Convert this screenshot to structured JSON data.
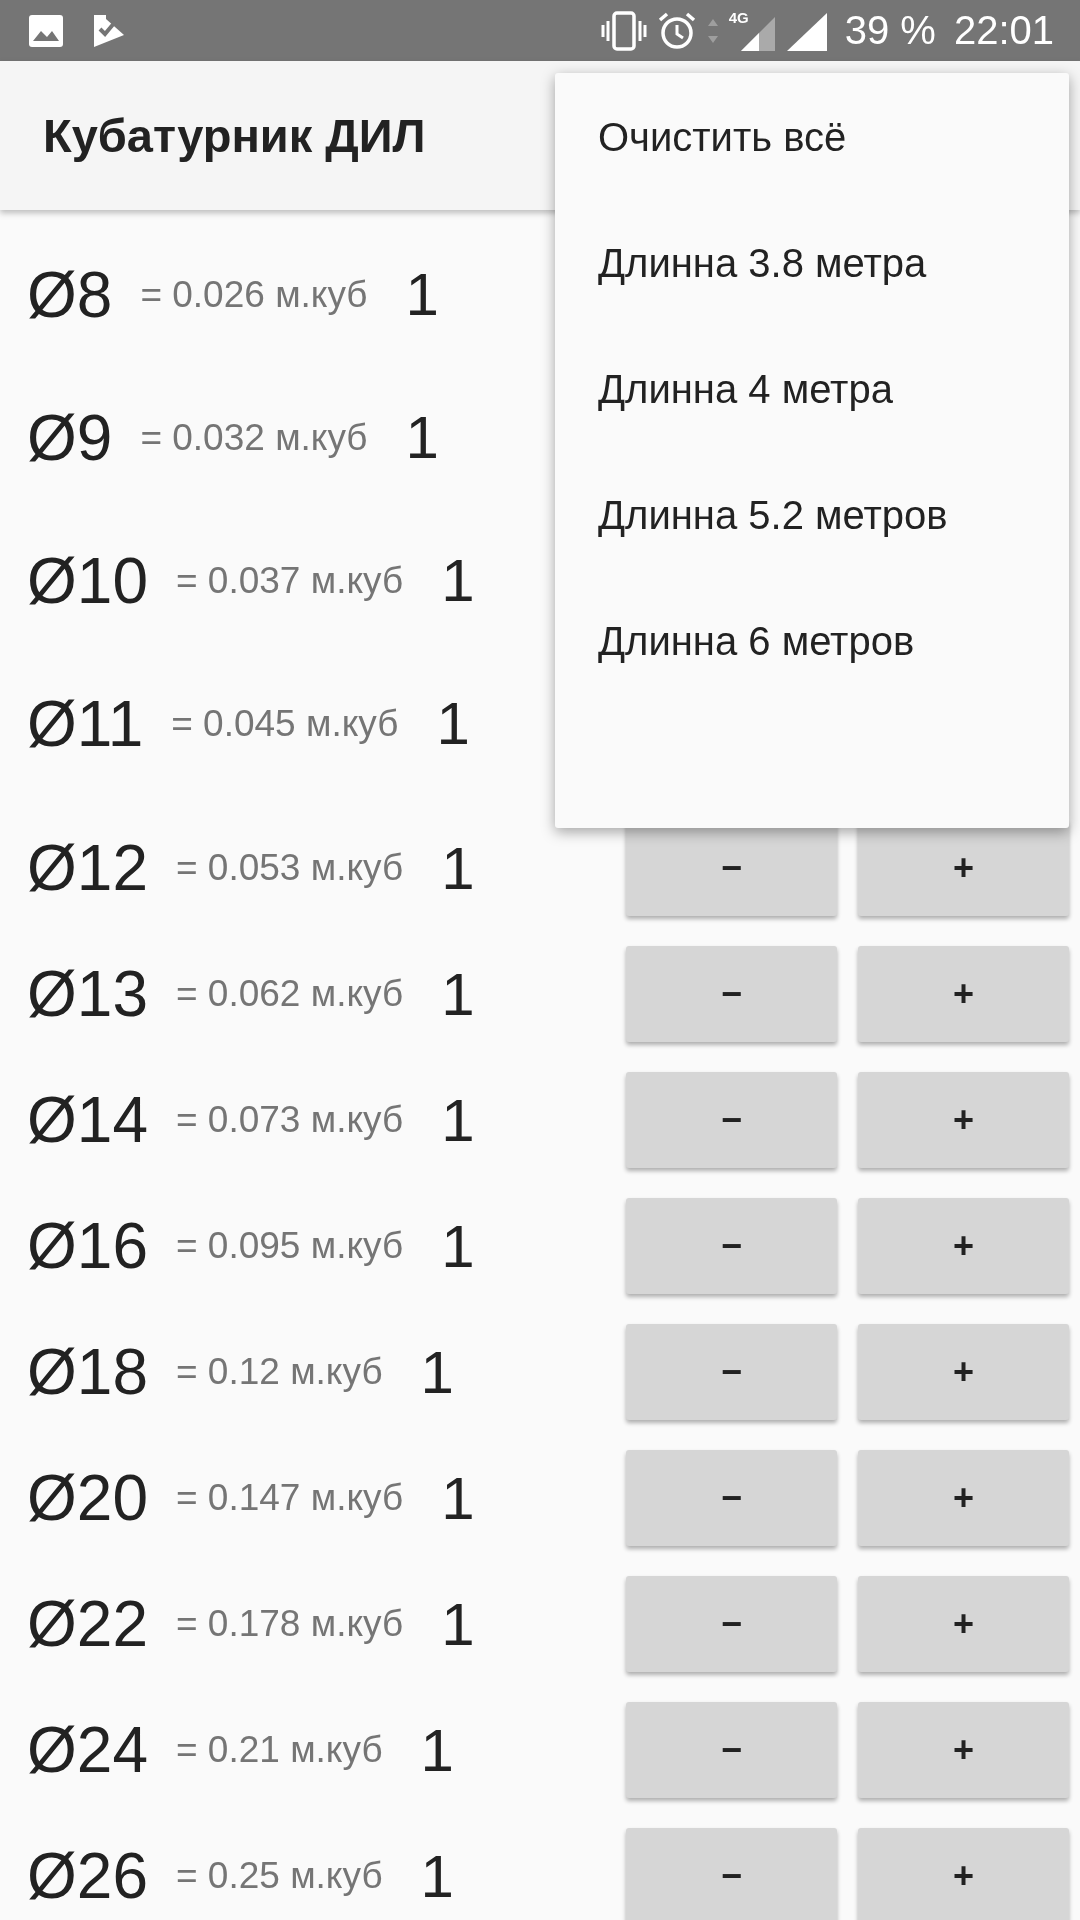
{
  "status_bar": {
    "network_type": "4G",
    "battery": "39 %",
    "time": "22:01"
  },
  "app_bar": {
    "title": "Кубатурник ДИЛ"
  },
  "rows": [
    {
      "diameter": "Ø8",
      "volume": "= 0.026 м.куб",
      "count": "1"
    },
    {
      "diameter": "Ø9",
      "volume": "= 0.032 м.куб",
      "count": "1"
    },
    {
      "diameter": "Ø10",
      "volume": "= 0.037 м.куб",
      "count": "1"
    },
    {
      "diameter": "Ø11",
      "volume": "= 0.045 м.куб",
      "count": "1"
    },
    {
      "diameter": "Ø12",
      "volume": "= 0.053 м.куб",
      "count": "1",
      "minus": "−",
      "plus": "+"
    },
    {
      "diameter": "Ø13",
      "volume": "= 0.062 м.куб",
      "count": "1",
      "minus": "−",
      "plus": "+"
    },
    {
      "diameter": "Ø14",
      "volume": "= 0.073 м.куб",
      "count": "1",
      "minus": "−",
      "plus": "+"
    },
    {
      "diameter": "Ø16",
      "volume": "= 0.095 м.куб",
      "count": "1",
      "minus": "−",
      "plus": "+"
    },
    {
      "diameter": "Ø18",
      "volume": "= 0.12 м.куб",
      "count": "1",
      "minus": "−",
      "plus": "+"
    },
    {
      "diameter": "Ø20",
      "volume": "= 0.147 м.куб",
      "count": "1",
      "minus": "−",
      "plus": "+"
    },
    {
      "diameter": "Ø22",
      "volume": "= 0.178 м.куб",
      "count": "1",
      "minus": "−",
      "plus": "+"
    },
    {
      "diameter": "Ø24",
      "volume": "= 0.21 м.куб",
      "count": "1",
      "minus": "−",
      "plus": "+"
    },
    {
      "diameter": "Ø26",
      "volume": "= 0.25 м.куб",
      "count": "1",
      "minus": "−",
      "plus": "+"
    }
  ],
  "menu": {
    "items": [
      "Очистить всё",
      "Длинна 3.8 метра",
      "Длинна 4 метра",
      "Длинна 5.2 метров",
      "Длинна 6 метров"
    ]
  }
}
